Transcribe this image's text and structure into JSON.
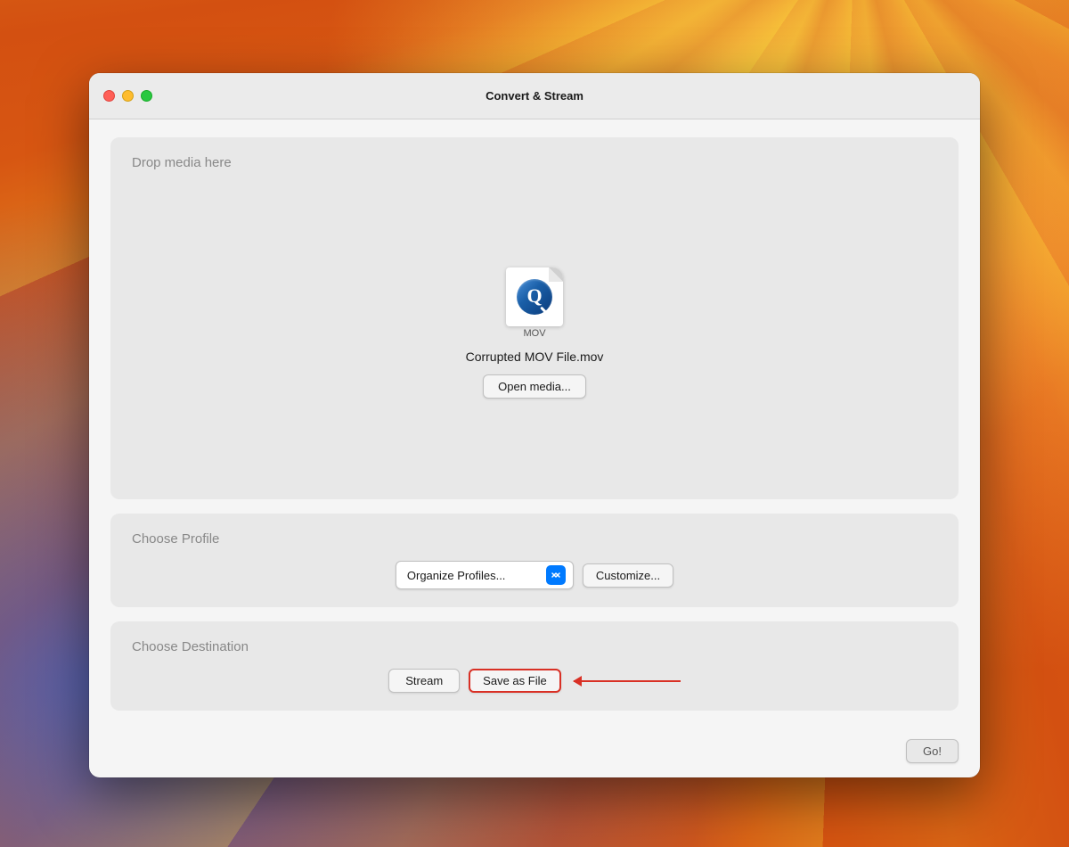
{
  "background": {
    "description": "macOS Ventura gradient background"
  },
  "window": {
    "title": "Convert & Stream",
    "traffic_lights": {
      "close_label": "close",
      "minimize_label": "minimize",
      "maximize_label": "maximize"
    }
  },
  "drop_media_section": {
    "label": "Drop media here",
    "file_icon_label": "MOV",
    "file_name": "Corrupted MOV File.mov",
    "open_button_label": "Open media..."
  },
  "choose_profile_section": {
    "label": "Choose Profile",
    "dropdown_value": "Organize Profiles...",
    "customize_button_label": "Customize..."
  },
  "choose_destination_section": {
    "label": "Choose Destination",
    "stream_button_label": "Stream",
    "save_as_file_button_label": "Save as File"
  },
  "footer": {
    "go_button_label": "Go!"
  }
}
